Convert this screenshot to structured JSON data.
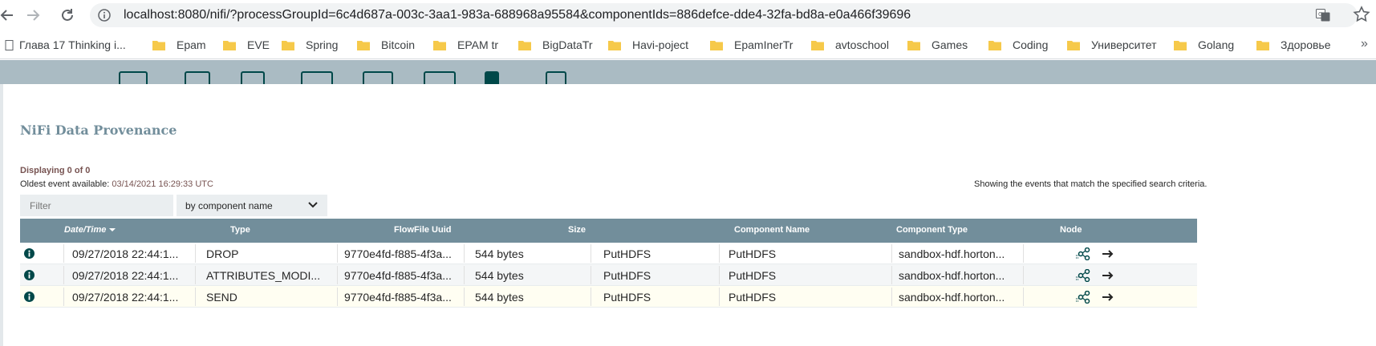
{
  "browser": {
    "url": "localhost:8080/nifi/?processGroupId=6c4d687a-003c-3aa1-983a-688968a95584&componentIds=886defce-dde4-32fa-bd8a-e0a466f39696",
    "bookmarks": [
      "Глава 17 Thinking i...",
      "Epam",
      "EVE",
      "Spring",
      "Bitcoin",
      "EPAM tr",
      "BigDataTr",
      "Havi-poject",
      "EpamInerTr",
      "avtoschool",
      "Games",
      "Coding",
      "Университет",
      "Golang",
      "Здоровье"
    ],
    "more": "»"
  },
  "dialog": {
    "title": "NiFi Data Provenance",
    "displaying": "Displaying 0 of 0",
    "oldest_label": "Oldest event available:",
    "oldest_value": "03/14/2021 16:29:33 UTC",
    "showing": "Showing the events that match the specified search criteria.",
    "filter_placeholder": "Filter",
    "filter_by": "by component name"
  },
  "table": {
    "columns": {
      "datetime": "Date/Time",
      "type": "Type",
      "uuid": "FlowFile Uuid",
      "size": "Size",
      "component_name": "Component Name",
      "component_type": "Component Type",
      "node": "Node"
    },
    "rows": [
      {
        "datetime": "09/27/2018 22:44:1...",
        "type": "DROP",
        "uuid": "9770e4fd-f885-4f3a...",
        "size": "544 bytes",
        "component_name": "PutHDFS",
        "component_type": "PutHDFS",
        "node": "sandbox-hdf.horton..."
      },
      {
        "datetime": "09/27/2018 22:44:1...",
        "type": "ATTRIBUTES_MODI...",
        "uuid": "9770e4fd-f885-4f3a...",
        "size": "544 bytes",
        "component_name": "PutHDFS",
        "component_type": "PutHDFS",
        "node": "sandbox-hdf.horton..."
      },
      {
        "datetime": "09/27/2018 22:44:1...",
        "type": "SEND",
        "uuid": "9770e4fd-f885-4f3a...",
        "size": "544 bytes",
        "component_name": "PutHDFS",
        "component_type": "PutHDFS",
        "node": "sandbox-hdf.horton..."
      }
    ]
  },
  "colors": {
    "header_bg": "#728e9b",
    "title": "#728e9b",
    "accent_red": "#775351",
    "highlight_row": "#fffef2",
    "folder": "#f6c94a"
  }
}
